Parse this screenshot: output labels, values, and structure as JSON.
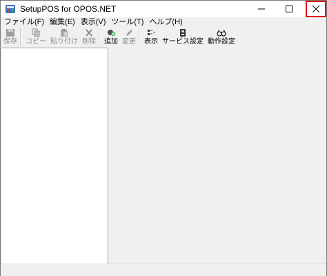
{
  "window": {
    "title": "SetupPOS for OPOS.NET",
    "minimize_icon": "minimize-icon",
    "maximize_icon": "maximize-icon",
    "close_icon": "close-icon",
    "close_highlight_color": "#e00000"
  },
  "menu": {
    "items": [
      {
        "label": "ファイル(F)"
      },
      {
        "label": "編集(E)"
      },
      {
        "label": "表示(V)"
      },
      {
        "label": "ツール(T)"
      },
      {
        "label": "ヘルプ(H)"
      }
    ]
  },
  "toolbar": {
    "save": {
      "label": "保存",
      "icon": "save-icon",
      "enabled": false
    },
    "copy": {
      "label": "コピー",
      "icon": "copy-icon",
      "enabled": false
    },
    "paste": {
      "label": "貼り付け",
      "icon": "paste-icon",
      "enabled": false
    },
    "delete": {
      "label": "削除",
      "icon": "delete-icon",
      "enabled": false
    },
    "add": {
      "label": "追加",
      "icon": "add-icon",
      "enabled": true
    },
    "change": {
      "label": "変更",
      "icon": "edit-icon",
      "enabled": false
    },
    "view": {
      "label": "表示",
      "icon": "view-icon",
      "enabled": true
    },
    "service": {
      "label": "サービス設定",
      "icon": "service-settings-icon",
      "enabled": true
    },
    "operation": {
      "label": "動作設定",
      "icon": "glasses-icon",
      "enabled": true
    }
  }
}
